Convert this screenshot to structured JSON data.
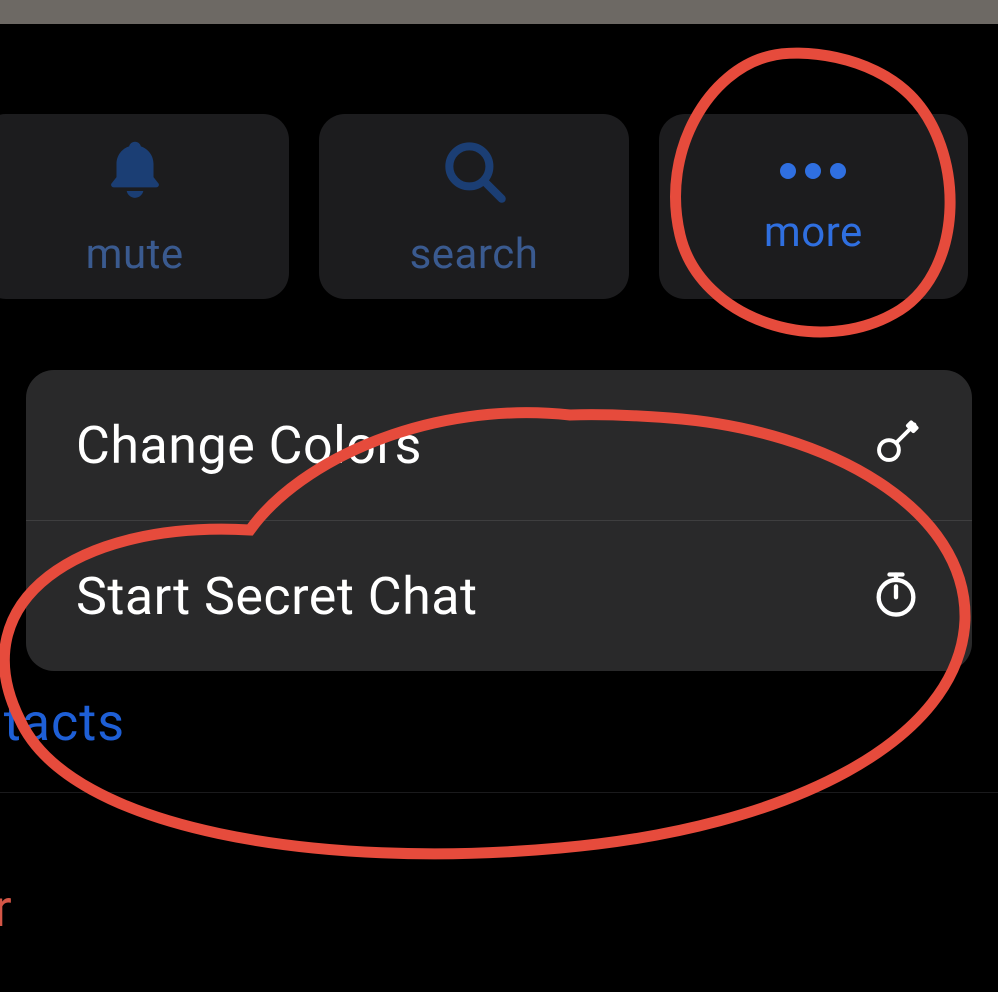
{
  "colors": {
    "accent": "#2f6fe0",
    "icon_blue": "#1b3e74",
    "label_blue": "#3a5a8f",
    "annotation_red": "#e64b3c"
  },
  "actions": {
    "mute": {
      "label": "mute",
      "icon": "bell-icon"
    },
    "search": {
      "label": "search",
      "icon": "search-icon"
    },
    "more": {
      "label": "more",
      "icon": "more-icon"
    }
  },
  "menu": {
    "items": [
      {
        "label": "Change Colors",
        "icon": "paintbrush-icon"
      },
      {
        "label": "Start Secret Chat",
        "icon": "timer-icon"
      }
    ]
  },
  "background": {
    "contacts_fragment": "ntacts",
    "r_fragment": "r"
  }
}
